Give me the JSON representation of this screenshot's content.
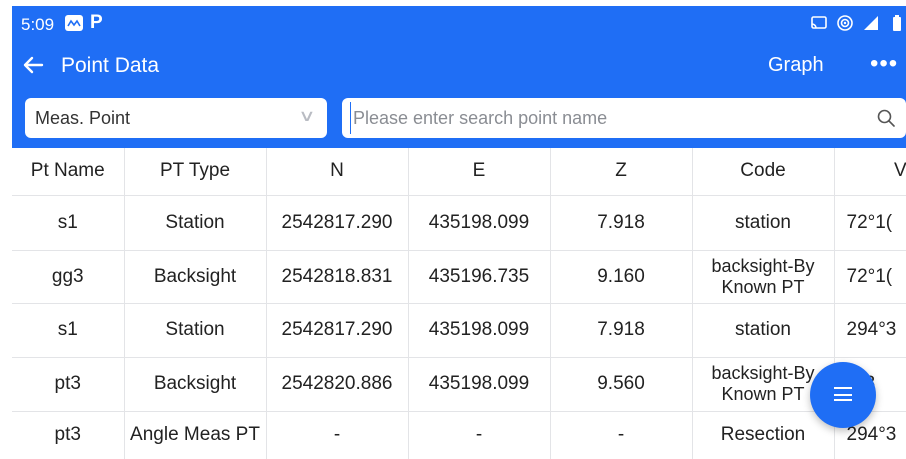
{
  "status_bar": {
    "time": "5:09",
    "app_icons": [
      "mail-icon",
      "p-icon"
    ],
    "p_label": "P",
    "right_icons": [
      "cast-icon",
      "hotspot-icon",
      "signal-icon",
      "battery-icon"
    ]
  },
  "app_bar": {
    "title": "Point Data",
    "graph_label": "Graph",
    "more_label": "•••"
  },
  "filter": {
    "type_selected": "Meas. Point",
    "search_placeholder": "Please enter search point name"
  },
  "table": {
    "columns": [
      "Pt Name",
      "PT Type",
      "N",
      "E",
      "Z",
      "Code",
      "V/"
    ],
    "rows": [
      {
        "pt_name": "s1",
        "pt_type": "Station",
        "n": "2542817.290",
        "e": "435198.099",
        "z": "7.918",
        "code": "station",
        "va": "72°1("
      },
      {
        "pt_name": "gg3",
        "pt_type": "Backsight",
        "n": "2542818.831",
        "e": "435196.735",
        "z": "9.160",
        "code": "backsight-By Known PT",
        "va": "72°1("
      },
      {
        "pt_name": "s1",
        "pt_type": "Station",
        "n": "2542817.290",
        "e": "435198.099",
        "z": "7.918",
        "code": "station",
        "va": "294°3"
      },
      {
        "pt_name": "pt3",
        "pt_type": "Backsight",
        "n": "2542820.886",
        "e": "435198.099",
        "z": "9.560",
        "code": "backsight-By Known PT",
        "va": "4°3"
      },
      {
        "pt_name": "pt3",
        "pt_type": "Angle Meas PT",
        "n": "-",
        "e": "-",
        "z": "-",
        "code": "Resection",
        "va": "294°3"
      }
    ]
  },
  "fab": {
    "icon": "menu-icon"
  },
  "colors": {
    "primary": "#1f6ef5",
    "grid": "#e3e4e7",
    "placeholder": "#8a8d93"
  }
}
